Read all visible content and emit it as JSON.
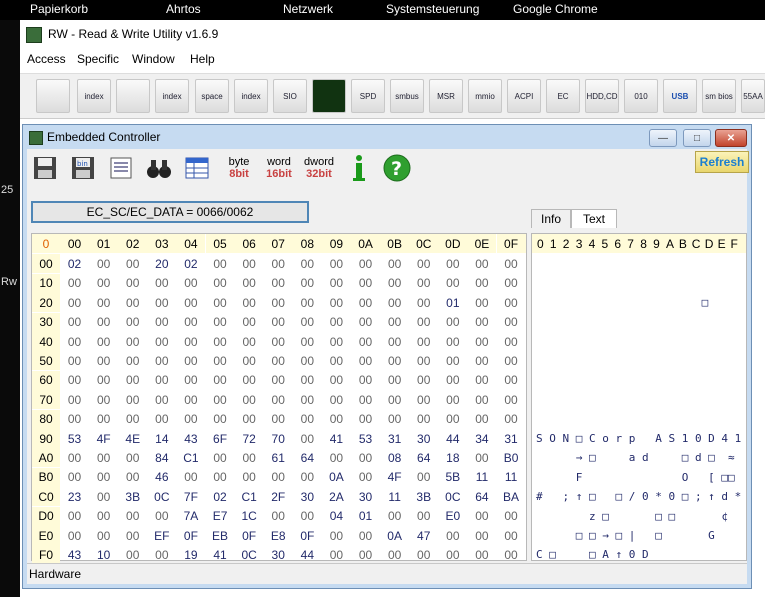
{
  "desktop": {
    "taskbar": [
      "Papierkorb",
      "Ahrtos",
      "Netzwerk",
      "Systemsteuerung",
      "Google Chrome"
    ],
    "side_labels": [
      "25",
      "Rw"
    ]
  },
  "app": {
    "title": "RW - Read & Write Utility v1.6.9",
    "menu": [
      "Access",
      "Specific",
      "Window",
      "Help"
    ],
    "toolbar": [
      {
        "icon": "pci-icon",
        "label": ""
      },
      {
        "icon": "pci-index-icon",
        "label": "index"
      },
      {
        "icon": "memory-icon",
        "label": ""
      },
      {
        "icon": "memory-index-icon",
        "label": "index"
      },
      {
        "icon": "io-space-icon",
        "label": "space"
      },
      {
        "icon": "io-index-icon",
        "label": "index"
      },
      {
        "icon": "sio-icon",
        "label": "SIO"
      },
      {
        "icon": "oscilloscope-icon",
        "label": ""
      },
      {
        "icon": "spd-icon",
        "label": "SPD"
      },
      {
        "icon": "smbus-icon",
        "label": "smbus"
      },
      {
        "icon": "msr-icon",
        "label": "MSR"
      },
      {
        "icon": "mmio-icon",
        "label": "mmio"
      },
      {
        "icon": "acpi-icon",
        "label": "ACPI"
      },
      {
        "icon": "ec-icon",
        "label": "EC"
      },
      {
        "icon": "hdd-cd-icon",
        "label": "HDD,CD"
      },
      {
        "icon": "disk-icon",
        "label": "010"
      },
      {
        "icon": "usb-icon",
        "label": "USB"
      },
      {
        "icon": "smbios-icon",
        "label": "sm bios"
      },
      {
        "icon": "more-icon",
        "label": "55AA"
      }
    ]
  },
  "ec": {
    "title": "Embedded Controller",
    "toolbar": {
      "byte_top": "byte",
      "byte_bot": "8bit",
      "word_top": "word",
      "word_bot": "16bit",
      "dword_top": "dword",
      "dword_bot": "32bit"
    },
    "refresh": "Refresh",
    "port": "EC_SC/EC_DATA = 0066/0062",
    "tabs": [
      "Info",
      "Text"
    ],
    "status": "Hardware",
    "corner": "0",
    "col_headers": [
      "00",
      "01",
      "02",
      "03",
      "04",
      "05",
      "06",
      "07",
      "08",
      "09",
      "0A",
      "0B",
      "0C",
      "0D",
      "0E",
      "0F"
    ],
    "rows": [
      {
        "label": "00",
        "cells": [
          "02",
          "00",
          "00",
          "20",
          "02",
          "00",
          "00",
          "00",
          "00",
          "00",
          "00",
          "00",
          "00",
          "00",
          "00",
          "00"
        ]
      },
      {
        "label": "10",
        "cells": [
          "00",
          "00",
          "00",
          "00",
          "00",
          "00",
          "00",
          "00",
          "00",
          "00",
          "00",
          "00",
          "00",
          "00",
          "00",
          "00"
        ]
      },
      {
        "label": "20",
        "cells": [
          "00",
          "00",
          "00",
          "00",
          "00",
          "00",
          "00",
          "00",
          "00",
          "00",
          "00",
          "00",
          "00",
          "01",
          "00",
          "00"
        ]
      },
      {
        "label": "30",
        "cells": [
          "00",
          "00",
          "00",
          "00",
          "00",
          "00",
          "00",
          "00",
          "00",
          "00",
          "00",
          "00",
          "00",
          "00",
          "00",
          "00"
        ]
      },
      {
        "label": "40",
        "cells": [
          "00",
          "00",
          "00",
          "00",
          "00",
          "00",
          "00",
          "00",
          "00",
          "00",
          "00",
          "00",
          "00",
          "00",
          "00",
          "00"
        ]
      },
      {
        "label": "50",
        "cells": [
          "00",
          "00",
          "00",
          "00",
          "00",
          "00",
          "00",
          "00",
          "00",
          "00",
          "00",
          "00",
          "00",
          "00",
          "00",
          "00"
        ]
      },
      {
        "label": "60",
        "cells": [
          "00",
          "00",
          "00",
          "00",
          "00",
          "00",
          "00",
          "00",
          "00",
          "00",
          "00",
          "00",
          "00",
          "00",
          "00",
          "00"
        ]
      },
      {
        "label": "70",
        "cells": [
          "00",
          "00",
          "00",
          "00",
          "00",
          "00",
          "00",
          "00",
          "00",
          "00",
          "00",
          "00",
          "00",
          "00",
          "00",
          "00"
        ]
      },
      {
        "label": "80",
        "cells": [
          "00",
          "00",
          "00",
          "00",
          "00",
          "00",
          "00",
          "00",
          "00",
          "00",
          "00",
          "00",
          "00",
          "00",
          "00",
          "00"
        ]
      },
      {
        "label": "90",
        "cells": [
          "53",
          "4F",
          "4E",
          "14",
          "43",
          "6F",
          "72",
          "70",
          "00",
          "41",
          "53",
          "31",
          "30",
          "44",
          "34",
          "31"
        ]
      },
      {
        "label": "A0",
        "cells": [
          "00",
          "00",
          "00",
          "84",
          "C1",
          "00",
          "00",
          "61",
          "64",
          "00",
          "00",
          "08",
          "64",
          "18",
          "00",
          "B0"
        ]
      },
      {
        "label": "B0",
        "cells": [
          "00",
          "00",
          "00",
          "46",
          "00",
          "00",
          "00",
          "00",
          "00",
          "0A",
          "00",
          "4F",
          "00",
          "5B",
          "11",
          "11"
        ]
      },
      {
        "label": "C0",
        "cells": [
          "23",
          "00",
          "3B",
          "0C",
          "7F",
          "02",
          "C1",
          "2F",
          "30",
          "2A",
          "30",
          "11",
          "3B",
          "0C",
          "64",
          "BA"
        ]
      },
      {
        "label": "D0",
        "cells": [
          "00",
          "00",
          "00",
          "00",
          "7A",
          "E7",
          "1C",
          "00",
          "00",
          "04",
          "01",
          "00",
          "00",
          "E0",
          "00",
          "00"
        ]
      },
      {
        "label": "E0",
        "cells": [
          "00",
          "00",
          "00",
          "EF",
          "0F",
          "EB",
          "0F",
          "E8",
          "0F",
          "00",
          "00",
          "0A",
          "47",
          "00",
          "00",
          "00"
        ]
      },
      {
        "label": "F0",
        "cells": [
          "43",
          "10",
          "00",
          "00",
          "19",
          "41",
          "0C",
          "30",
          "44",
          "00",
          "00",
          "00",
          "00",
          "00",
          "00",
          "00"
        ]
      }
    ],
    "text_header": [
      "0",
      "1",
      "2",
      "3",
      "4",
      "5",
      "6",
      "7",
      "8",
      "9",
      "A",
      "B",
      "C",
      "D",
      "E",
      "F"
    ],
    "text_lines": [
      "",
      "",
      "                         □",
      "",
      "",
      "",
      "",
      "",
      "",
      "S O N □ C o r p   A S 1 0 D 4 1",
      "      → □     a d     □ d □  ≈",
      "      F               O   [ □□",
      "#   ; ↑ □   □ / 0 * 0 □ ; ↑ d *",
      "        z □       □ □       ¢",
      "      □ □ → □ |   □       G",
      "C □     □ A ↑ 0 D"
    ]
  }
}
